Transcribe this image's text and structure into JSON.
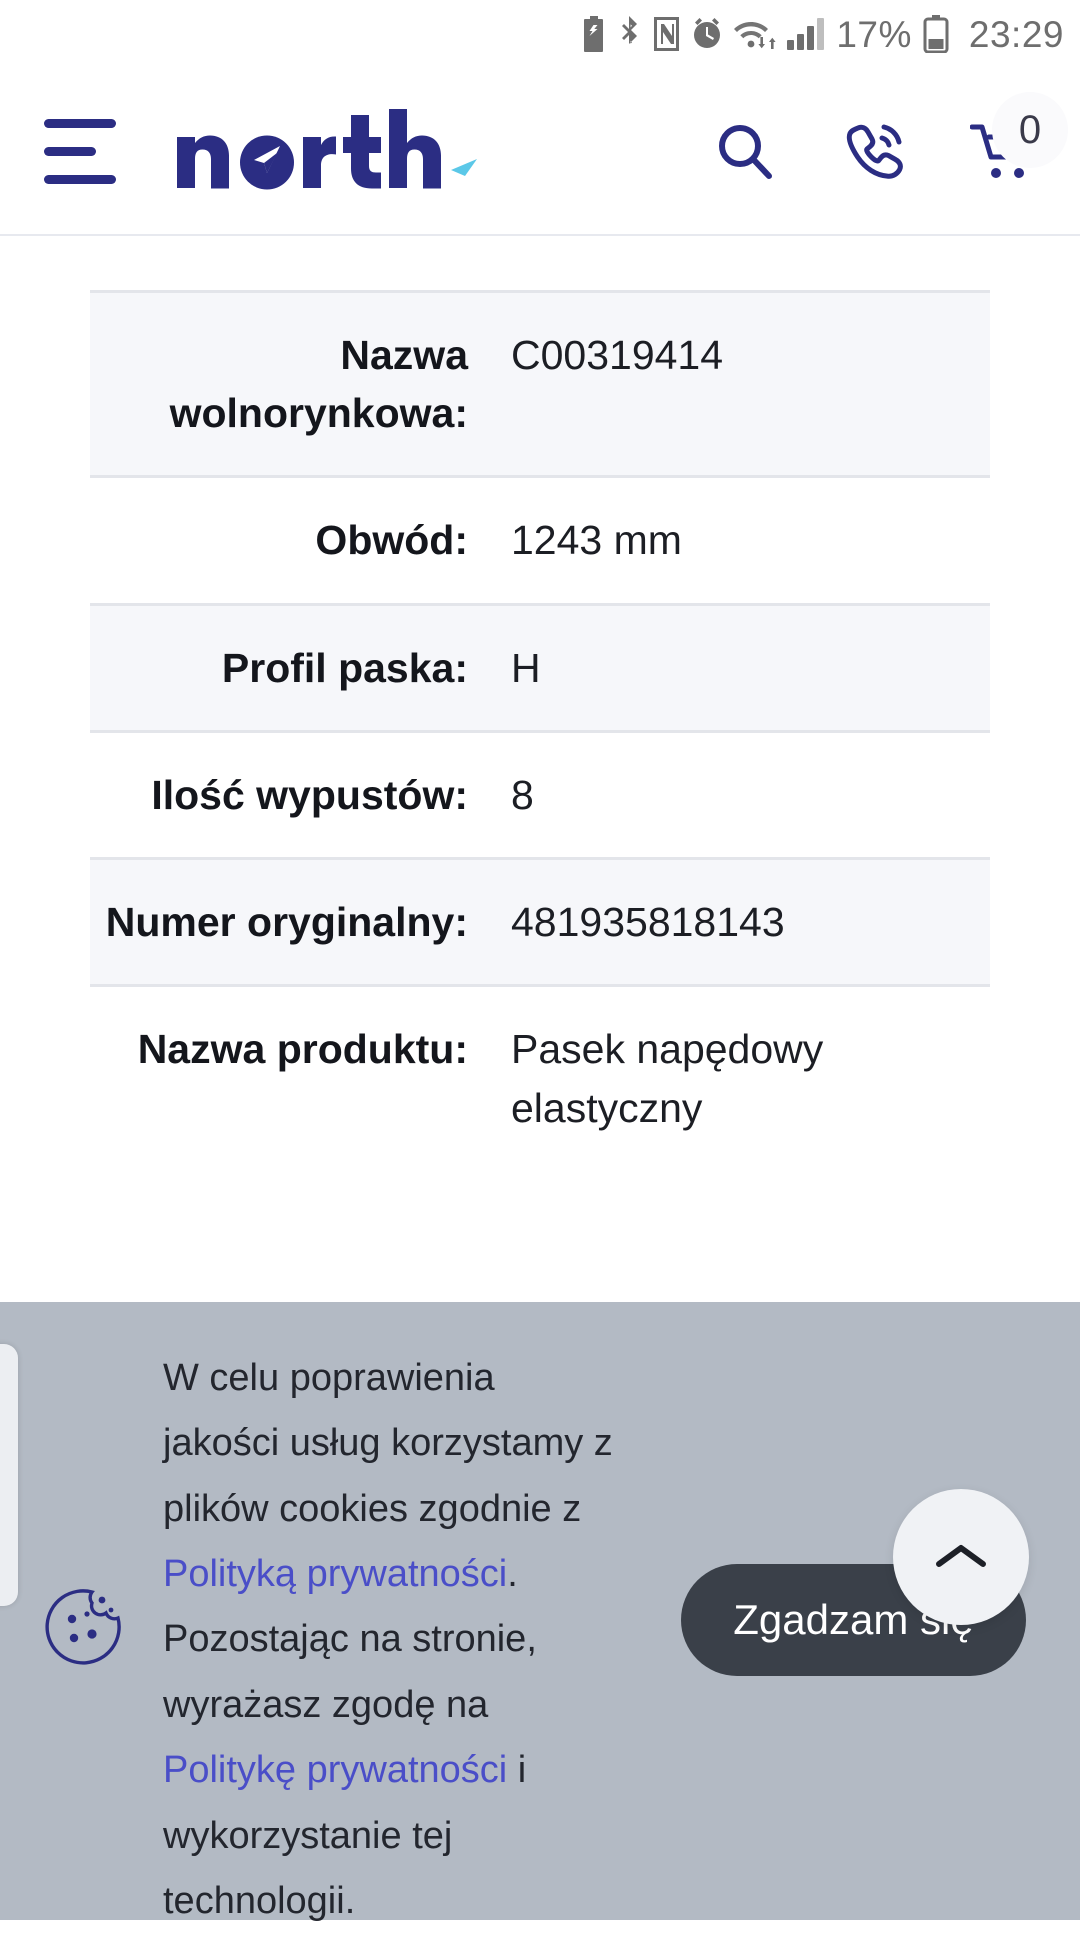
{
  "status_bar": {
    "icons": [
      "battery-saver-icon",
      "bluetooth-icon",
      "nfc-icon",
      "alarm-icon",
      "wifi-icon",
      "cellular-signal-icon"
    ],
    "battery_percent": "17%",
    "battery_icon": "battery-icon",
    "time": "23:29"
  },
  "header": {
    "menu_icon": "hamburger-menu-icon",
    "logo_text": "north",
    "search_icon": "search-icon",
    "phone_icon": "phone-icon",
    "cart_icon": "cart-icon",
    "cart_count": "0",
    "brand_color": "#2b2d83",
    "accent_color": "#5bc8e8"
  },
  "spec_table": {
    "rows": [
      {
        "label": "Nazwa wolnorynkowa:",
        "value": "C00319414",
        "shaded": true
      },
      {
        "label": "Obwód:",
        "value": "1243 mm",
        "shaded": false
      },
      {
        "label": "Profil paska:",
        "value": "H",
        "shaded": true
      },
      {
        "label": "Ilość wypustów:",
        "value": "8",
        "shaded": false
      },
      {
        "label": "Numer oryginalny:",
        "value": "481935818143",
        "shaded": true
      },
      {
        "label": "Nazwa produktu:",
        "value": "Pasek napędowy elastyczny",
        "shaded": false
      }
    ]
  },
  "cookie_banner": {
    "icon": "cookie-icon",
    "text_part_1": "W celu poprawienia jakości usług korzystamy z plików cookies zgodnie z ",
    "link_1": "Polityką prywatności",
    "text_part_2": ". Pozostając na stronie, wyrażasz zgodę na ",
    "link_2": "Politykę prywatności",
    "text_part_3": " i wykorzystanie tej technologii.",
    "agree_label": "Zgadzam się",
    "background_color": "#b3bac4",
    "link_color": "#4a4ec8",
    "button_color": "#3a4049"
  },
  "scroll_top": {
    "icon": "chevron-up-icon"
  }
}
